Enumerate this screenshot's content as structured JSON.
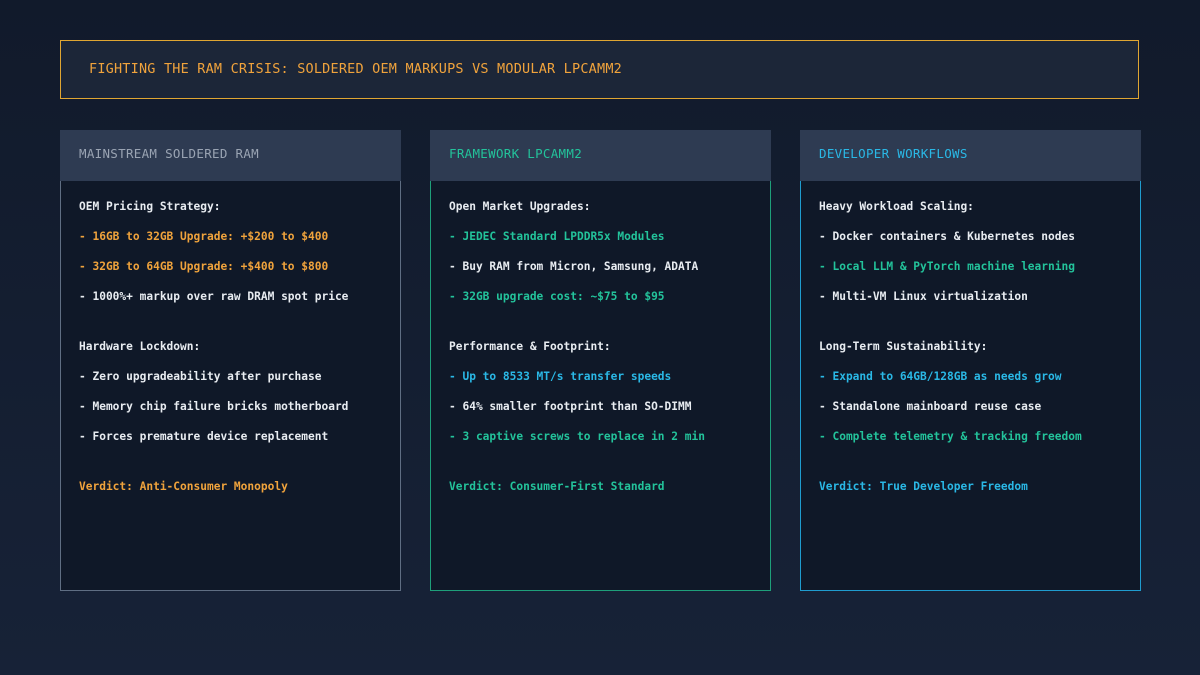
{
  "title": "FIGHTING THE RAM CRISIS: SOLDERED OEM MARKUPS VS MODULAR LPCAMM2",
  "colors": {
    "accent_orange": "#f0a33c",
    "accent_green": "#23c39b",
    "accent_blue": "#2ab8e6",
    "text_white": "#e8ecf1",
    "muted_gray": "#9aa4b3",
    "panel_bg": "#0f1828",
    "header_bg": "#2e3b52"
  },
  "columns": [
    {
      "header": "MAINSTREAM SOLDERED RAM",
      "section1_title": "OEM Pricing Strategy:",
      "section1_items": [
        "- 16GB to 32GB Upgrade: +$200 to $400",
        "- 32GB to 64GB Upgrade: +$400 to $800",
        "- 1000%+ markup over raw DRAM spot price"
      ],
      "section2_title": "Hardware Lockdown:",
      "section2_items": [
        "- Zero upgradeability after purchase",
        "- Memory chip failure bricks motherboard",
        "- Forces premature device replacement"
      ],
      "verdict": "Verdict: Anti-Consumer Monopoly"
    },
    {
      "header": "FRAMEWORK LPCAMM2",
      "section1_title": "Open Market Upgrades:",
      "section1_items": [
        "- JEDEC Standard LPDDR5x Modules",
        "- Buy RAM from Micron, Samsung, ADATA",
        "- 32GB upgrade cost: ~$75 to $95"
      ],
      "section2_title": "Performance & Footprint:",
      "section2_items": [
        "- Up to 8533 MT/s transfer speeds",
        "- 64% smaller footprint than SO-DIMM",
        "- 3 captive screws to replace in 2 min"
      ],
      "verdict": "Verdict: Consumer-First Standard"
    },
    {
      "header": "DEVELOPER WORKFLOWS",
      "section1_title": "Heavy Workload Scaling:",
      "section1_items": [
        "- Docker containers & Kubernetes nodes",
        "- Local LLM & PyTorch machine learning",
        "- Multi-VM Linux virtualization"
      ],
      "section2_title": "Long-Term Sustainability:",
      "section2_items": [
        "- Expand to 64GB/128GB as needs grow",
        "- Standalone mainboard reuse case",
        "- Complete telemetry & tracking freedom"
      ],
      "verdict": "Verdict: True Developer Freedom"
    }
  ]
}
